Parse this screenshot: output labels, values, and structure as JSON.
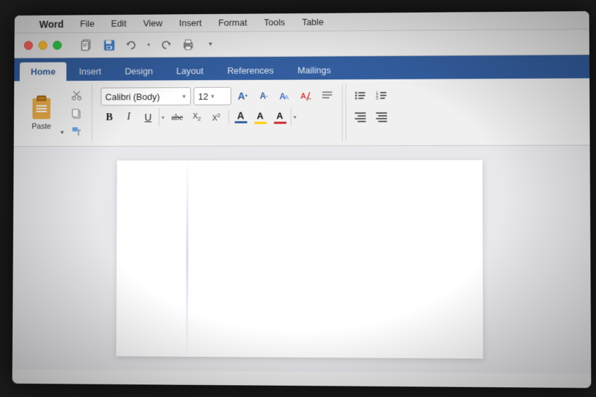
{
  "app": {
    "name": "Word",
    "apple_symbol": ""
  },
  "menubar": {
    "items": [
      {
        "label": "Word",
        "bold": true
      },
      {
        "label": "File"
      },
      {
        "label": "Edit"
      },
      {
        "label": "View"
      },
      {
        "label": "Insert"
      },
      {
        "label": "Format"
      },
      {
        "label": "Tools"
      },
      {
        "label": "Table"
      }
    ]
  },
  "toolbar": {
    "icons": [
      "file-icon",
      "save-icon",
      "undo-icon",
      "redo-icon",
      "print-icon",
      "dropdown-icon"
    ]
  },
  "ribbon": {
    "tabs": [
      {
        "label": "Home",
        "active": true
      },
      {
        "label": "Insert"
      },
      {
        "label": "Design"
      },
      {
        "label": "Layout"
      },
      {
        "label": "References"
      },
      {
        "label": "Mailings"
      }
    ],
    "paste_label": "Paste",
    "font_name": "Calibri (Body)",
    "font_size": "12",
    "font_size_arrow": "▾",
    "font_name_arrow": "▾",
    "format_buttons": [
      {
        "label": "B",
        "type": "bold"
      },
      {
        "label": "I",
        "type": "italic"
      },
      {
        "label": "U",
        "type": "underline"
      },
      {
        "label": "abe",
        "type": "strikethrough"
      },
      {
        "label": "X₂",
        "type": "subscript"
      },
      {
        "label": "X²",
        "type": "superscript"
      }
    ],
    "colors": {
      "font_color": "#1a1a1a",
      "highlight_yellow": "#ffff00",
      "underline_red": "#ff0000"
    }
  },
  "document": {
    "background_color": "#e8e8ec",
    "page_color": "#ffffff"
  }
}
